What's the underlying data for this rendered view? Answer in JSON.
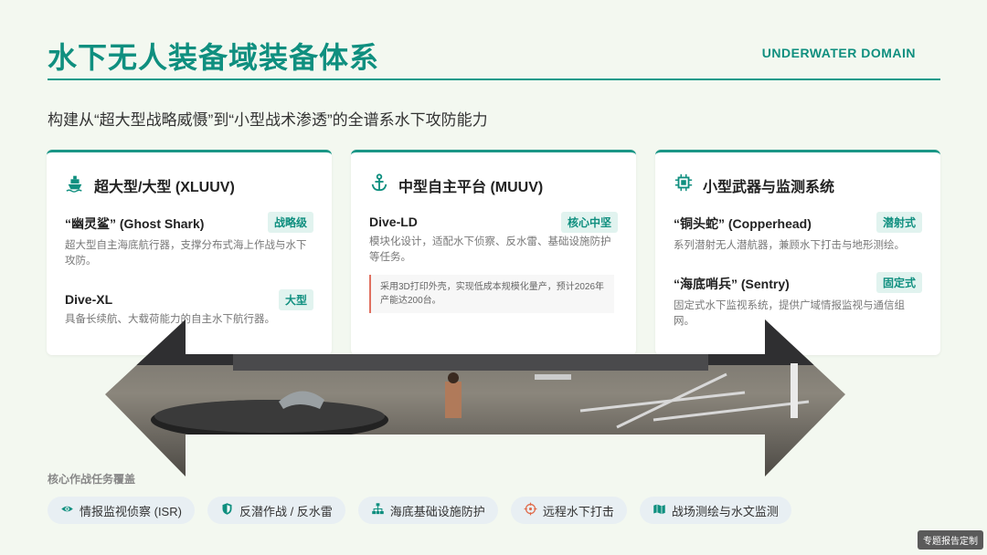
{
  "header": {
    "title": "水下无人装备域装备体系",
    "domain_tag": "UNDERWATER DOMAIN",
    "subtitle": "构建从“超大型战略威慑”到“小型战术渗透”的全谱系水下攻防能力"
  },
  "cards": [
    {
      "icon": "ship-icon",
      "title": "超大型/大型 (XLUUV)",
      "items": [
        {
          "name": "“幽灵鲨” (Ghost Shark)",
          "badge": "战略级",
          "desc": "超大型自主海底航行器，支撑分布式海上作战与水下攻防。"
        },
        {
          "name": "Dive-XL",
          "badge": "大型",
          "desc": "具备长续航、大载荷能力的自主水下航行器。"
        }
      ]
    },
    {
      "icon": "anchor-icon",
      "title": "中型自主平台 (MUUV)",
      "items": [
        {
          "name": "Dive-LD",
          "badge": "核心中坚",
          "desc": "模块化设计，适配水下侦察、反水雷、基础设施防护等任务。"
        }
      ],
      "note": "采用3D打印外壳，实现低成本规模化量产，预计2026年产能达200台。"
    },
    {
      "icon": "chip-icon",
      "title": "小型武器与监测系统",
      "items": [
        {
          "name": "“铜头蛇” (Copperhead)",
          "badge": "潜射式",
          "desc": "系列潜射无人潜航器，兼顾水下打击与地形测绘。"
        },
        {
          "name": "“海底哨兵” (Sentry)",
          "badge": "固定式",
          "desc": "固定式水下监视系统，提供广域情报监视与通信组网。"
        }
      ]
    }
  ],
  "missions": {
    "label": "核心作战任务覆盖",
    "items": [
      {
        "icon": "eye-icon",
        "label": "情报监视侦察 (ISR)"
      },
      {
        "icon": "shield-icon",
        "label": "反潜作战 / 反水雷"
      },
      {
        "icon": "network-icon",
        "label": "海底基础设施防护"
      },
      {
        "icon": "crosshair-icon",
        "label": "远程水下打击"
      },
      {
        "icon": "map-icon",
        "label": "战场测绘与水文监测"
      }
    ]
  },
  "footer": {
    "corner_tag": "专题报告定制"
  },
  "colors": {
    "accent": "#0f8f7f",
    "background": "#f3f8f0",
    "badge_bg": "#e1f3ef"
  }
}
